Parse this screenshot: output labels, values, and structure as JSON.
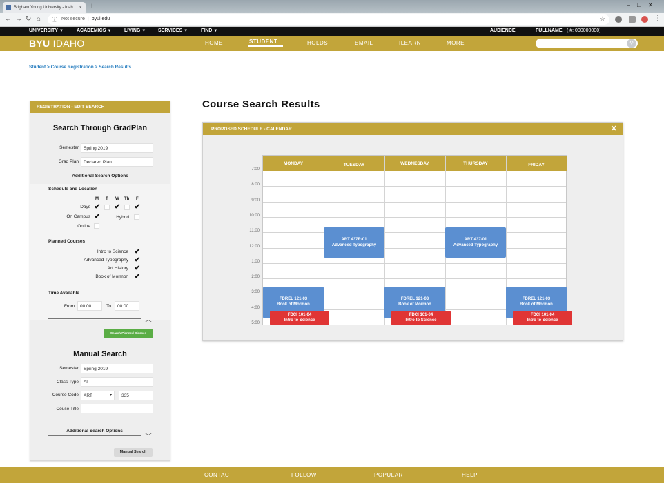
{
  "browser": {
    "tab_title": "Brigham Young University - Idah",
    "tab_close": "×",
    "new_tab": "+",
    "not_secure": "Not secure",
    "url": "byui.edu"
  },
  "topbar": {
    "menus": [
      "UNIVERSITY",
      "ACADEMICS",
      "LIVING",
      "SERVICES",
      "FIND"
    ],
    "audience": "AUDIENCE",
    "fullname": "FULLNAME",
    "id": "(I#: 000000000)"
  },
  "header": {
    "logo_bold": "BYU",
    "logo_light": "IDAHO",
    "nav": [
      "HOME",
      "STUDENT",
      "HOLDS",
      "EMAIL",
      "ILEARN",
      "MORE"
    ],
    "active_nav": "STUDENT"
  },
  "breadcrumb": "Student > Course Registration > Search Results",
  "left_panel": {
    "header": "REGISTRATION - EDIT SEARCH",
    "gradplan_title": "Search Through GradPlan",
    "semester_label": "Semester",
    "semester_value": "Spring 2019",
    "gradplan_label": "Grad Plan",
    "gradplan_value": "Declared Plan",
    "additional_options": "Additional Search Options",
    "schedule_location": "Schedule and Location",
    "day_letters": [
      "M",
      "T",
      "W",
      "Th",
      "F"
    ],
    "days_label": "Days",
    "days_checked": [
      true,
      false,
      true,
      false,
      true
    ],
    "on_campus_label": "On Campus",
    "on_campus_checked": true,
    "hybrid_label": "Hybrid",
    "hybrid_checked": false,
    "online_label": "Online",
    "online_checked": false,
    "planned_courses_label": "Planned Courses",
    "planned_courses": [
      "Intro to Science",
      "Advanced Typography",
      "Art History",
      "Book of Mormon"
    ],
    "time_available_label": "Time Available",
    "from_label": "From",
    "from_value": "00:00",
    "to_label": "To",
    "to_value": "00:00",
    "search_planned_button": "Search Planned Classes",
    "manual_title": "Manual Search",
    "m_semester_label": "Semester",
    "m_semester_value": "Spring 2019",
    "class_type_label": "Class Type",
    "class_type_value": "All",
    "course_code_label": "Course Code",
    "course_code_subject": "ART",
    "course_code_number": "335",
    "course_title_label": "Couse Title",
    "course_title_value": "",
    "m_additional_options": "Additional Search Options",
    "manual_search_button": "Manual Search"
  },
  "results": {
    "title": "Course Search Results",
    "calendar_header": "PROPOSED SCHEDULE - CALENDAR",
    "close": "✕",
    "days": [
      "MONDAY",
      "TUESDAY",
      "WEDNESDAY",
      "THURSDAY",
      "FRIDAY"
    ],
    "times": [
      "7:00",
      "8:00",
      "9:00",
      "10:00",
      "11:00",
      "12:00",
      "1:00",
      "2:00",
      "3:00",
      "4:00",
      "5:00"
    ],
    "events": [
      {
        "day": "TUESDAY",
        "code": "ART 437R-01",
        "title": "Advanced Typography",
        "color": "#5b8fd1"
      },
      {
        "day": "THURSDAY",
        "code": "ART 437-01",
        "title": "Advanced Typography",
        "color": "#5b8fd1"
      },
      {
        "day": "MONDAY",
        "code": "FDREL 121-03",
        "title": "Book of Mormon",
        "color": "#5b8fd1"
      },
      {
        "day": "WEDNESDAY",
        "code": "FDREL 121-03",
        "title": "Book of Mormon",
        "color": "#5b8fd1"
      },
      {
        "day": "FRIDAY",
        "code": "FDREL 121-03",
        "title": "Book of Mormon",
        "color": "#5b8fd1"
      },
      {
        "day": "MONDAY",
        "code": "FDCI 101-04",
        "title": "Intro to Science",
        "color": "#e03535"
      },
      {
        "day": "WEDNESDAY",
        "code": "FDCI 101-04",
        "title": "Intro to Science",
        "color": "#e03535"
      },
      {
        "day": "FRIDAY",
        "code": "FDCI 101-04",
        "title": "Intro to Science",
        "color": "#e03535"
      }
    ]
  },
  "footer": [
    "CONTACT",
    "FOLLOW",
    "POPULAR",
    "HELP"
  ],
  "colors": {
    "brand_gold": "#c2a53a",
    "event_blue": "#5b8fd1",
    "event_red": "#e03535",
    "button_green": "#5aad45"
  }
}
